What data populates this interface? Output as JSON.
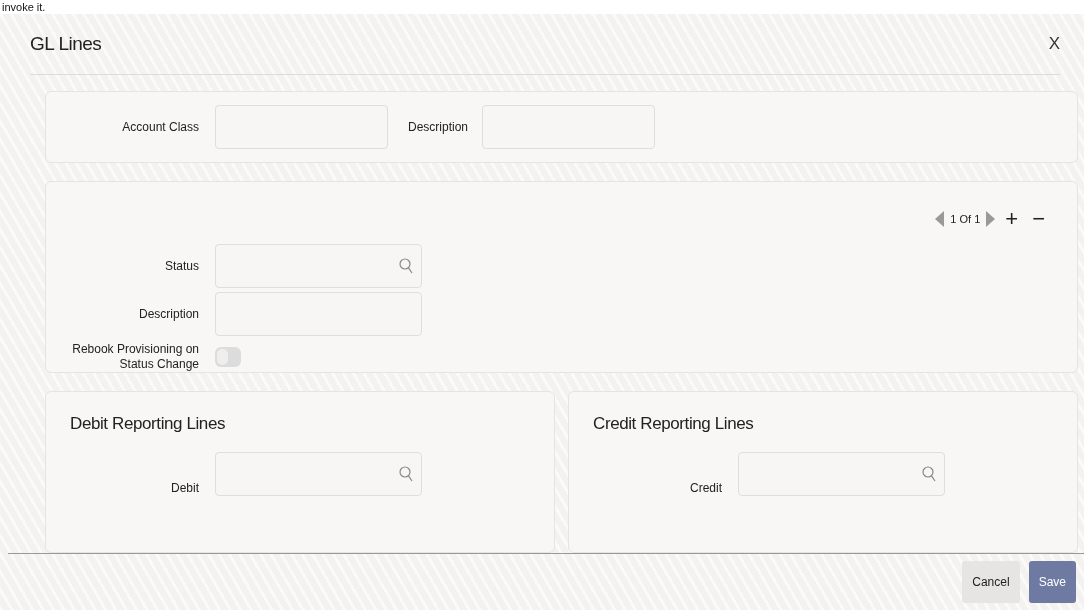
{
  "page_caption": "invoke it.",
  "window": {
    "title": "GL Lines",
    "close": "X"
  },
  "header_section": {
    "fields": [
      {
        "label": "Account Class"
      },
      {
        "label": "Description"
      }
    ]
  },
  "status_section": {
    "pager": {
      "text": "1 Of 1",
      "add": "+",
      "remove": "−"
    },
    "fields": [
      {
        "label": "Status",
        "kind": "lookup"
      },
      {
        "label": "Description",
        "kind": "text"
      },
      {
        "label": "Rebook Provisioning on Status Change",
        "kind": "toggle",
        "on": false
      }
    ]
  },
  "reporting_sections": [
    {
      "title": "Debit Reporting Lines",
      "field_label": "Debit"
    },
    {
      "title": "Credit Reporting Lines",
      "field_label": "Credit"
    }
  ],
  "buttons": [
    {
      "label": "Cancel",
      "kind": "secondary"
    },
    {
      "label": "Save",
      "kind": "primary"
    }
  ]
}
